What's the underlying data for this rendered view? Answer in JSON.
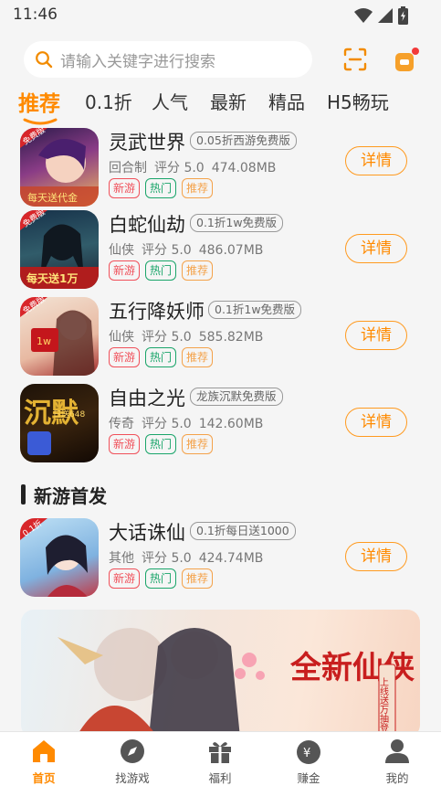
{
  "status": {
    "time": "11:46"
  },
  "search": {
    "placeholder": "请输入关键字进行搜索"
  },
  "tabs": [
    {
      "label": "推荐",
      "active": true
    },
    {
      "label": "0.1折"
    },
    {
      "label": "人气"
    },
    {
      "label": "最新"
    },
    {
      "label": "精品"
    },
    {
      "label": "H5畅玩"
    }
  ],
  "games": [
    {
      "name": "灵武世界",
      "subtitle": "0.05折西游免费版",
      "genre": "回合制",
      "rating": "评分 5.0",
      "size": "474.08MB",
      "tags": [
        "新游",
        "热门",
        "推荐"
      ],
      "detail": "详情",
      "icon_text": "每天送代金",
      "badge": "免费版"
    },
    {
      "name": "白蛇仙劫",
      "subtitle": "0.1折1w免费版",
      "genre": "仙侠",
      "rating": "评分 5.0",
      "size": "486.07MB",
      "tags": [
        "新游",
        "热门",
        "推荐"
      ],
      "detail": "详情",
      "icon_text": "每天送1万",
      "badge": "免费版"
    },
    {
      "name": "五行降妖师",
      "subtitle": "0.1折1w免费版",
      "genre": "仙侠",
      "rating": "评分 5.0",
      "size": "585.82MB",
      "tags": [
        "新游",
        "热门",
        "推荐"
      ],
      "detail": "详情",
      "icon_text": "1w",
      "badge": "免费版"
    },
    {
      "name": "自由之光",
      "subtitle": "龙族沉默免费版",
      "genre": "传奇",
      "rating": "评分 5.0",
      "size": "142.60MB",
      "tags": [
        "新游",
        "热门",
        "推荐"
      ],
      "detail": "详情",
      "icon_text": "沉默",
      "badge": "日送648"
    }
  ],
  "section": {
    "title": "新游首发"
  },
  "new_games": [
    {
      "name": "大话诛仙",
      "subtitle": "0.1折每日送1000",
      "genre": "其他",
      "rating": "评分 5.0",
      "size": "424.74MB",
      "tags": [
        "新游",
        "热门",
        "推荐"
      ],
      "detail": "详情",
      "badge": "0.1折"
    }
  ],
  "banner": {
    "headline": "全新仙侠",
    "side_text": "上线送万抽登录"
  },
  "bottom_nav": [
    {
      "label": "首页",
      "icon": "home-icon",
      "active": true
    },
    {
      "label": "找游戏",
      "icon": "compass-icon"
    },
    {
      "label": "福利",
      "icon": "gift-icon"
    },
    {
      "label": "赚金",
      "icon": "money-bag-icon"
    },
    {
      "label": "我的",
      "icon": "user-icon"
    }
  ],
  "colors": {
    "accent": "#ff8a00",
    "new_tag": "#f0505a",
    "hot_tag": "#1aa56a",
    "rec_tag": "#f4a24a",
    "background": "#f5f5f5"
  }
}
